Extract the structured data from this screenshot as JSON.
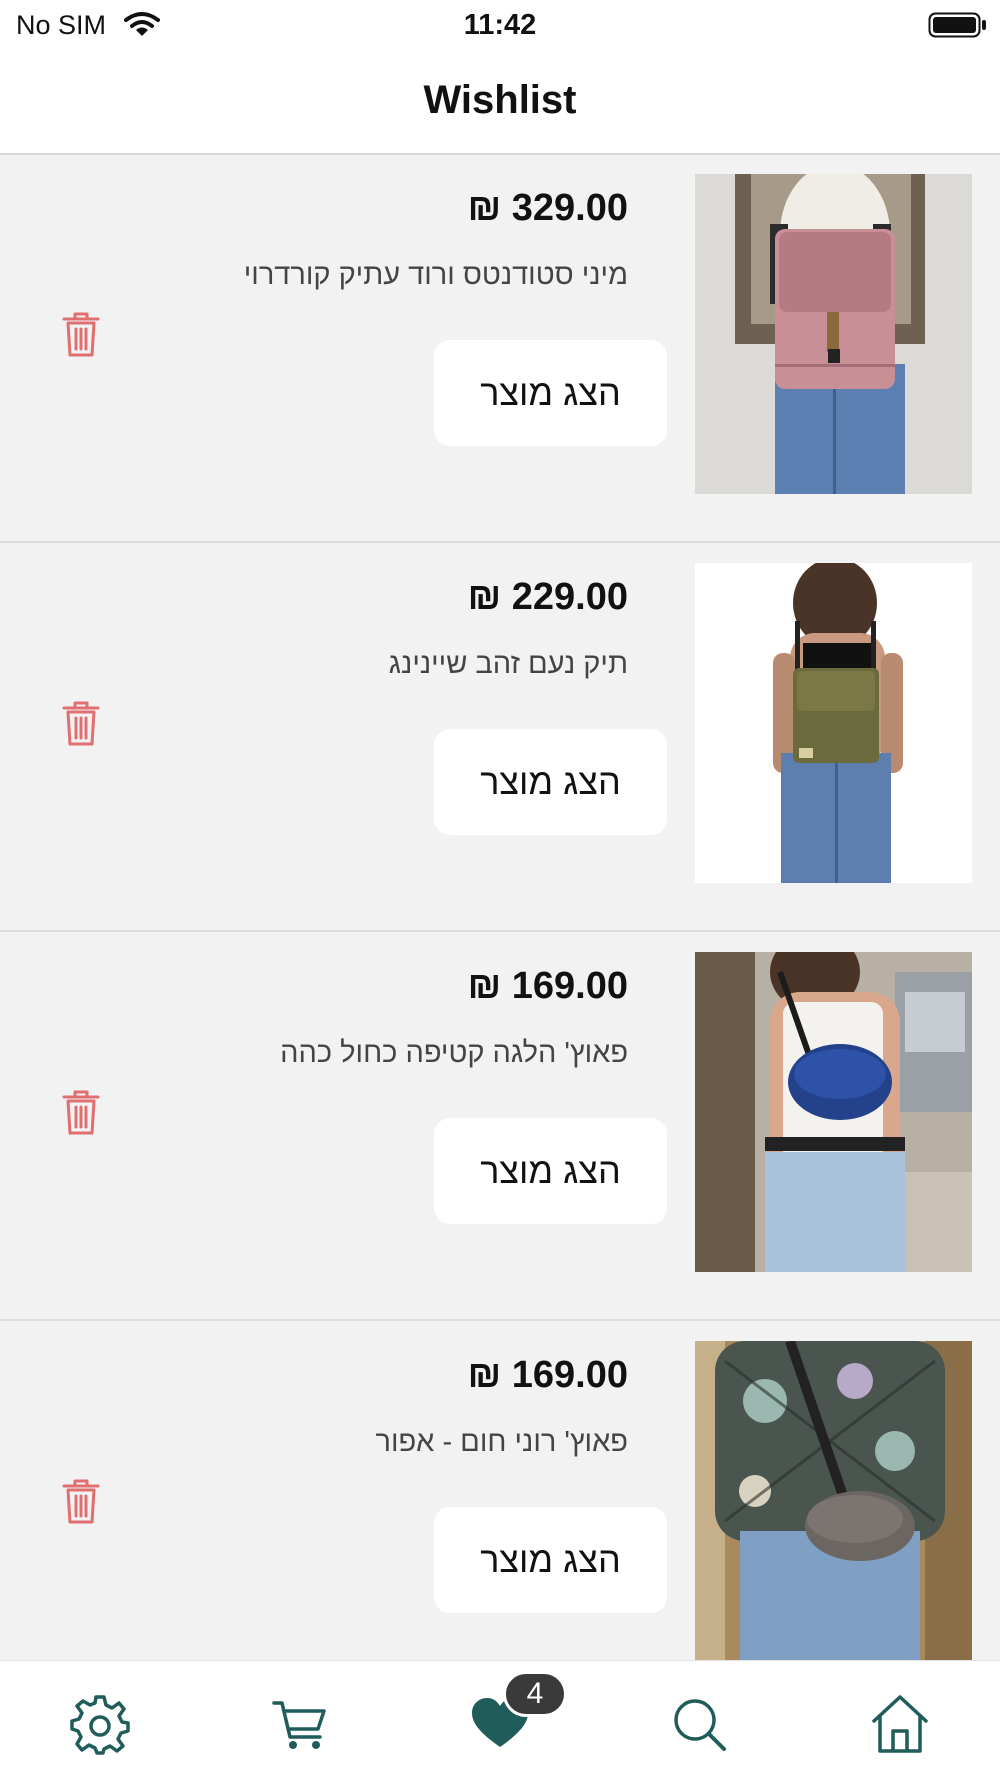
{
  "status_bar": {
    "carrier": "No SIM",
    "time": "11:42"
  },
  "header": {
    "title": "Wishlist"
  },
  "colors": {
    "accent": "#1f5c5a",
    "delete": "#e07070",
    "badge": "#3a3a3a"
  },
  "wishlist": {
    "items": [
      {
        "price": "₪ 329.00",
        "name": "מיני סטודנטס ורוד עתיק קורדרוי",
        "button": "הצג מוצר",
        "image": "pink-corduroy-backpack"
      },
      {
        "price": "₪ 229.00",
        "name": "תיק נעם זהב שיינינג",
        "button": "הצג מוצר",
        "image": "gold-shining-backpack"
      },
      {
        "price": "₪ 169.00",
        "name": "פאוץ' הלגה קטיפה כחול כהה",
        "button": "הצג מוצר",
        "image": "navy-velvet-beltbag"
      },
      {
        "price": "₪ 169.00",
        "name": "פאוץ' רוני חום - אפור",
        "button": "הצג מוצר",
        "image": "brown-grey-beltbag"
      }
    ]
  },
  "tab_bar": {
    "icons": [
      "settings-icon",
      "cart-icon",
      "heart-icon",
      "search-icon",
      "home-icon"
    ],
    "wishlist_count": "4"
  }
}
